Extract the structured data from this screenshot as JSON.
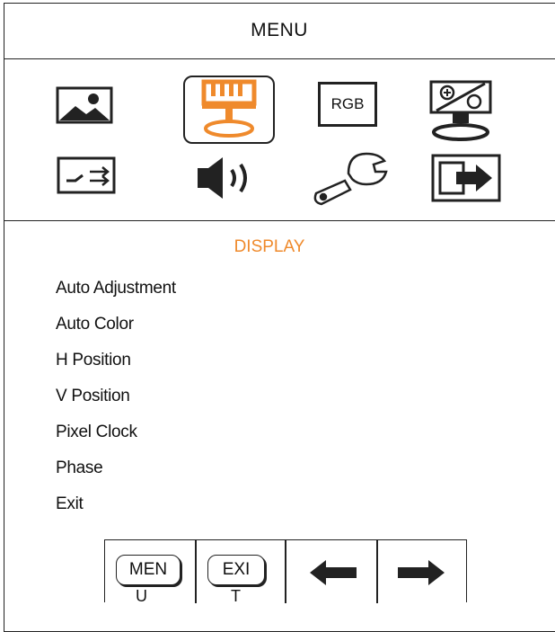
{
  "menu": {
    "title": "MENU"
  },
  "icons": [
    {
      "name": "picture-icon",
      "active": false
    },
    {
      "name": "display-icon",
      "active": true
    },
    {
      "name": "rgb-icon",
      "label": "RGB",
      "active": false
    },
    {
      "name": "pip-icon",
      "active": false
    },
    {
      "name": "input-source-icon",
      "active": false
    },
    {
      "name": "audio-icon",
      "active": false
    },
    {
      "name": "tools-icon",
      "active": false
    },
    {
      "name": "exit-icon",
      "active": false
    }
  ],
  "section": {
    "title": "DISPLAY"
  },
  "items": [
    "Auto Adjustment",
    "Auto Color",
    "H Position",
    "V Position",
    "Pixel Clock",
    "Phase",
    "Exit"
  ],
  "buttons": {
    "menu_cap": "MEN",
    "menu_spill": "U",
    "exit_cap": "EXI",
    "exit_spill": "T",
    "left_arrow": "left-arrow-icon",
    "right_arrow": "right-arrow-icon"
  },
  "colors": {
    "accent": "#ef8a2c",
    "line": "#222222"
  }
}
